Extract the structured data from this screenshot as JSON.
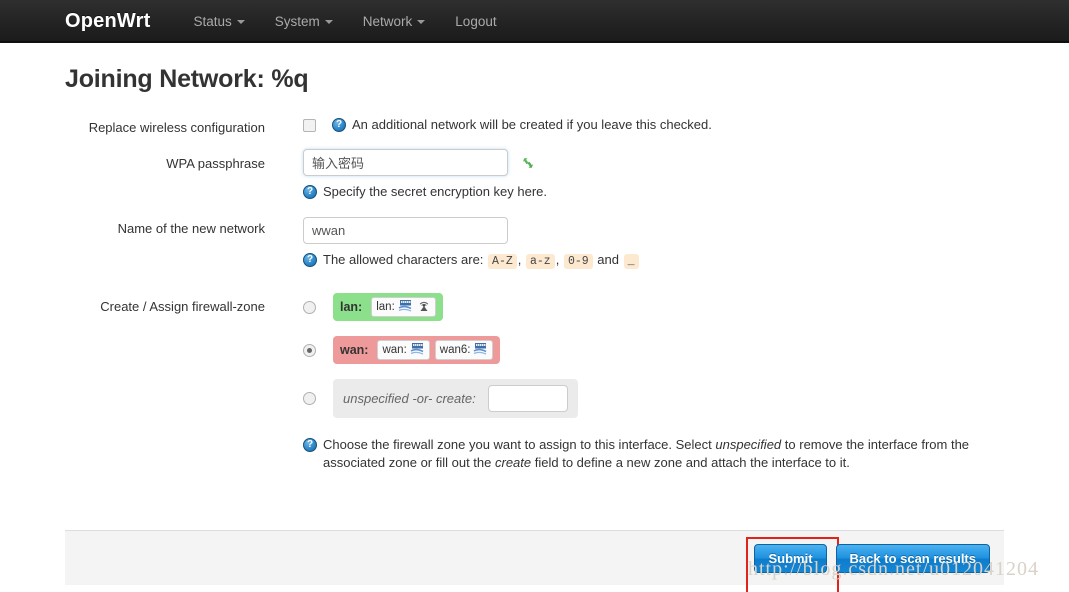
{
  "navbar": {
    "brand": "OpenWrt",
    "items": [
      {
        "label": "Status",
        "has_caret": true,
        "name": "status"
      },
      {
        "label": "System",
        "has_caret": true,
        "name": "system"
      },
      {
        "label": "Network",
        "has_caret": true,
        "name": "network"
      },
      {
        "label": "Logout",
        "has_caret": false,
        "name": "logout"
      }
    ]
  },
  "page": {
    "title": "Joining Network: %q"
  },
  "form": {
    "replace_wireless": {
      "label": "Replace wireless configuration",
      "checked": false,
      "hint": "An additional network will be created if you leave this checked."
    },
    "wpa_passphrase": {
      "label": "WPA passphrase",
      "value": "输入密码",
      "hint": "Specify the secret encryption key here.",
      "regen_icon": "recycle-icon"
    },
    "network_name": {
      "label": "Name of the new network",
      "value": "wwan",
      "hint_prefix": "The allowed characters are:",
      "allowed": [
        "A-Z",
        "a-z",
        "0-9"
      ],
      "hint_join": "and",
      "allowed_last": "_"
    },
    "firewall_zone": {
      "label": "Create / Assign firewall-zone",
      "selected": "wan",
      "zones": [
        {
          "id": "lan",
          "name": "lan:",
          "color": "#8ce08c",
          "selected": false,
          "interfaces": [
            {
              "label": "lan:",
              "icons": [
                "ethernet-icon",
                "wifi-icon"
              ]
            }
          ]
        },
        {
          "id": "wan",
          "name": "wan:",
          "color": "#ef9a9a",
          "selected": true,
          "interfaces": [
            {
              "label": "wan:",
              "icons": [
                "ethernet-icon"
              ]
            },
            {
              "label": "wan6:",
              "icons": [
                "ethernet-icon"
              ]
            }
          ]
        },
        {
          "id": "unspecified",
          "name": "unspecified -or- create:",
          "color": "#ebebeb",
          "selected": false,
          "create_value": "",
          "interfaces": []
        }
      ],
      "hint": "Choose the firewall zone you want to assign to this interface. Select unspecified to remove the interface from the associated zone or fill out the create field to define a new zone and attach the interface to it.",
      "hint_part1": "Choose the firewall zone you want to assign to this interface. Select ",
      "hint_em1": "unspecified",
      "hint_part2": " to remove the interface from the associated zone or fill out the ",
      "hint_em2": "create",
      "hint_part3": " field to define a new zone and attach the interface to it."
    }
  },
  "footer": {
    "submit_label": "Submit",
    "back_label": "Back to scan results",
    "highlight_color": "#e2231a"
  },
  "watermark": {
    "text": "http://blog.csdn.net/u012041204"
  }
}
